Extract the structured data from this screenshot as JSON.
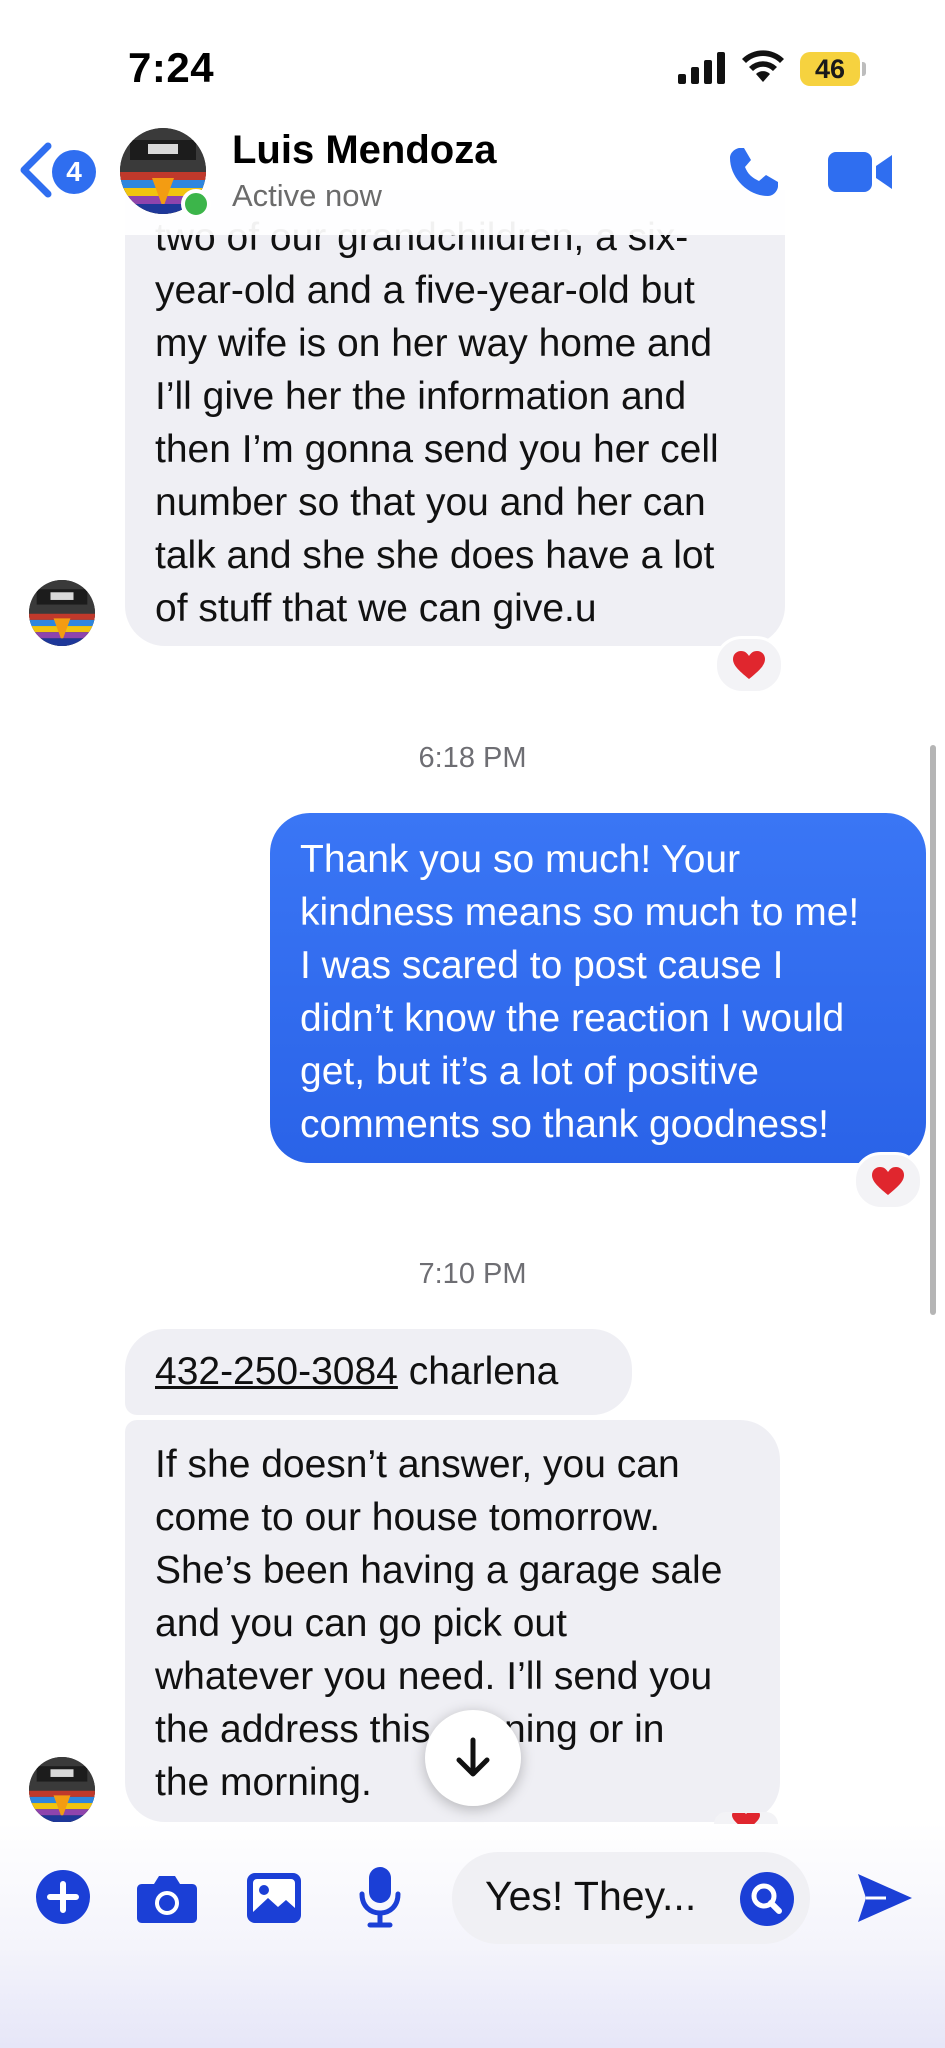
{
  "status_bar": {
    "time": "7:24",
    "battery": "46"
  },
  "header": {
    "back_badge": "4",
    "contact_name": "Luis Mendoza",
    "contact_status": "Active now"
  },
  "messages": [
    {
      "direction": "incoming",
      "text": "two of our grandchildren, a six-year-old and a five-year-old but my wife is on her way home and I’ll give her the information and then I’m gonna send you her cell number so that you and her can talk and she she does have a lot of stuff that we can give.u",
      "lines": [
        "two of our grandchildren, a six-",
        "year-old and a five-year-old but",
        "my wife is on her way home and",
        "I’ll give her the information and",
        "then I’m gonna send you her cell",
        "number so that you and her can",
        "talk and she she does have a lot",
        "of stuff that we can give.u"
      ],
      "reaction": "❤️"
    },
    {
      "timestamp": "6:18 PM"
    },
    {
      "direction": "outgoing",
      "lines": [
        "Thank you so much! Your",
        "kindness means so much to me!",
        "I was scared to post cause I",
        "didn’t know the reaction I would",
        "get, but it’s a lot of positive",
        "comments so thank goodness!"
      ],
      "reaction": "❤️"
    },
    {
      "timestamp": "7:10 PM"
    },
    {
      "direction": "incoming",
      "phone": "432-250-3084",
      "text_after": " charlena"
    },
    {
      "direction": "incoming",
      "lines": [
        "If she doesn’t answer, you can",
        "come to our house tomorrow.",
        "She’s been having a garage sale",
        "and you can go pick out",
        "whatever you need. I’ll send you",
        "the address this evening or in",
        "the morning."
      ],
      "reaction": "❤️"
    }
  ],
  "composer": {
    "input_value": "Yes! They...",
    "tools": [
      "plus-icon",
      "camera-icon",
      "image-icon",
      "microphone-icon"
    ]
  },
  "colors": {
    "accent": "#2f6ef0",
    "incoming_bubble": "#efeff4",
    "online": "#3cb54a",
    "battery": "#f6d23f"
  }
}
